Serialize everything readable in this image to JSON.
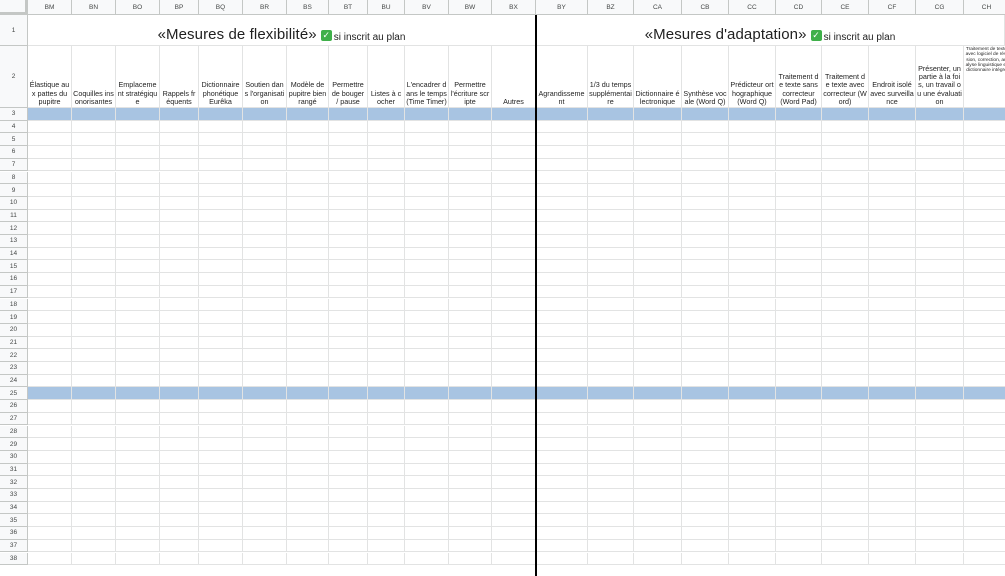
{
  "sheet": {
    "columns": [
      "BM",
      "BN",
      "BO",
      "BP",
      "BQ",
      "BR",
      "BS",
      "BT",
      "BU",
      "BV",
      "BW",
      "BX",
      "BY",
      "BZ",
      "CA",
      "CB",
      "CC",
      "CD",
      "CE",
      "CF",
      "CG",
      "CH"
    ],
    "row_numbers": [
      "1",
      "2",
      "3",
      "4",
      "5",
      "6",
      "7",
      "8",
      "9",
      "10",
      "11",
      "12",
      "13",
      "14",
      "15",
      "16",
      "17",
      "18",
      "19",
      "20",
      "21",
      "22",
      "23",
      "24",
      "25",
      "26",
      "27",
      "28",
      "29",
      "30",
      "31",
      "32",
      "33",
      "34",
      "35",
      "36",
      "37",
      "38"
    ],
    "highlighted_rows": [
      "3",
      "25"
    ],
    "colors": {
      "highlight_row": "#a8c4e2",
      "gridline": "#e2e3e3",
      "header_bg": "#f8f9fa",
      "section_divider": "#000000",
      "checkmark": "#3fb04a"
    }
  },
  "sections": {
    "flexibility": {
      "title": "«Mesures de flexibilité»",
      "note": "si inscrit au plan",
      "icon": "check-mark-icon"
    },
    "adaptation": {
      "title": "«Mesures d'adaptation»",
      "note": "si inscrit au plan",
      "icon": "check-mark-icon"
    }
  },
  "headers": {
    "BM": "Élastique aux pattes du pupitre",
    "BN": "Coquilles insonorisantes",
    "BO": "Emplacement stratégique",
    "BP": "Rappels fréquents",
    "BQ": "Dictionnaire phonétique Eurêka",
    "BR": "Soutien dans l'organisation",
    "BS": "Modèle de pupitre bien rangé",
    "BT": "Permettre de bouger / pause",
    "BU": "Listes à cocher",
    "BV": "L'encadrer dans le temps (Time Timer)",
    "BW": "Permettre l'écriture scripte",
    "BX": "Autres",
    "BY": "Agrandissement",
    "BZ": "1/3 du temps supplémentaire",
    "CA": "Dictionnaire électronique",
    "CB": "Synthèse vocale (Word Q)",
    "CC": "Prédicteur orthographique (Word Q)",
    "CD": "Traitement de texte sans correcteur (Word Pad)",
    "CE": "Traitement de texte avec correcteur (Word)",
    "CF": "Endroit isolé avec surveillance",
    "CG": "Présenter, un partie à la fois, un travail ou une évaluation",
    "CH": "Traitement de texte avec logiciel de révision, correction, analyse linguistique et dictionnaire intégré"
  }
}
